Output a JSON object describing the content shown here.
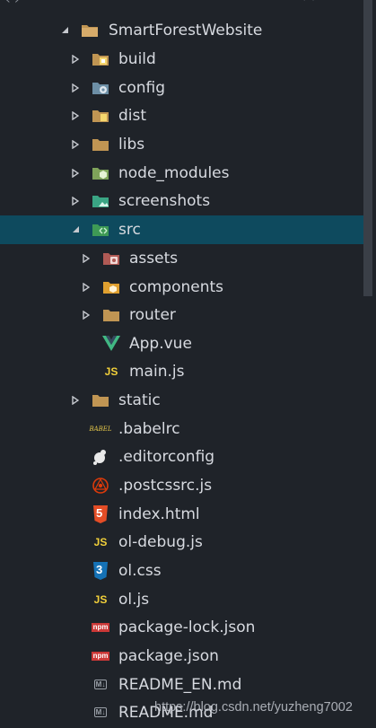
{
  "explorer": {
    "root": {
      "label": "SmartForestWebsite",
      "expanded": true,
      "icon": "folder-icon"
    },
    "items": [
      {
        "label": "build",
        "type": "folder",
        "icon": "folder-build-icon",
        "expanded": false
      },
      {
        "label": "config",
        "type": "folder",
        "icon": "folder-config-icon",
        "expanded": false
      },
      {
        "label": "dist",
        "type": "folder",
        "icon": "folder-dist-icon",
        "expanded": false
      },
      {
        "label": "libs",
        "type": "folder",
        "icon": "folder-icon",
        "expanded": false
      },
      {
        "label": "node_modules",
        "type": "folder",
        "icon": "folder-node-icon",
        "expanded": false
      },
      {
        "label": "screenshots",
        "type": "folder",
        "icon": "folder-images-icon",
        "expanded": false
      },
      {
        "label": "src",
        "type": "folder",
        "icon": "folder-src-icon",
        "expanded": true,
        "selected": true
      },
      {
        "label": "assets",
        "type": "folder",
        "icon": "folder-assets-icon",
        "expanded": false
      },
      {
        "label": "components",
        "type": "folder",
        "icon": "folder-components-icon",
        "expanded": false
      },
      {
        "label": "router",
        "type": "folder",
        "icon": "folder-icon",
        "expanded": false
      },
      {
        "label": "App.vue",
        "type": "file",
        "icon": "vue-icon"
      },
      {
        "label": "main.js",
        "type": "file",
        "icon": "js-icon"
      },
      {
        "label": "static",
        "type": "folder",
        "icon": "folder-icon",
        "expanded": false
      },
      {
        "label": ".babelrc",
        "type": "file",
        "icon": "babel-icon"
      },
      {
        "label": ".editorconfig",
        "type": "file",
        "icon": "editorconfig-icon"
      },
      {
        "label": ".postcssrc.js",
        "type": "file",
        "icon": "postcss-icon"
      },
      {
        "label": "index.html",
        "type": "file",
        "icon": "html5-icon"
      },
      {
        "label": "ol-debug.js",
        "type": "file",
        "icon": "js-icon"
      },
      {
        "label": "ol.css",
        "type": "file",
        "icon": "css3-icon"
      },
      {
        "label": "ol.js",
        "type": "file",
        "icon": "js-icon"
      },
      {
        "label": "package-lock.json",
        "type": "file",
        "icon": "npm-icon"
      },
      {
        "label": "package.json",
        "type": "file",
        "icon": "npm-icon"
      },
      {
        "label": "README_EN.md",
        "type": "file",
        "icon": "markdown-icon"
      },
      {
        "label": "README.md",
        "type": "file",
        "icon": "markdown-icon"
      }
    ]
  },
  "icon_glyphs": {
    "js": "JS",
    "babel": "BABEL",
    "markdown": "M↓",
    "npm": "npm",
    "html5": "5",
    "css3": "3"
  },
  "watermark": "https://blog.csdn.net/yuzheng7002",
  "colors": {
    "background": "#1f2329",
    "selected_row": "#0e4a5e",
    "text": "#d7dae0",
    "folder": "#c09553",
    "js": "#f2d03a",
    "vue": "#41b883",
    "html5": "#e44d26",
    "css3": "#1572b6",
    "npm": "#cb3837"
  }
}
